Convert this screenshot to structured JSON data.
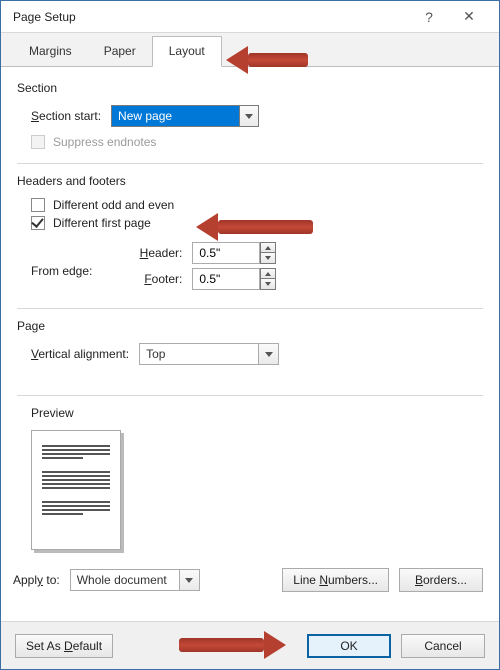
{
  "title": "Page Setup",
  "help": "?",
  "close": "✕",
  "tabs": {
    "margins": "Margins",
    "paper": "Paper",
    "layout": "Layout"
  },
  "section": {
    "header": "Section",
    "start_label": "Section start:",
    "start_value": "New page",
    "suppress_label": "Suppress endnotes"
  },
  "hf": {
    "header": "Headers and footers",
    "odd_even": "Different odd and even",
    "first_page": "Different first page",
    "from_edge": "From edge:",
    "header_label": "Header:",
    "header_value": "0.5\"",
    "footer_label": "Footer:",
    "footer_value": "0.5\""
  },
  "page": {
    "header": "Page",
    "valign_label": "Vertical alignment:",
    "valign_value": "Top"
  },
  "preview_label": "Preview",
  "apply_to_label": "Apply to:",
  "apply_to_value": "Whole document",
  "line_numbers_btn": "Line Numbers...",
  "borders_btn": "Borders...",
  "set_default_btn": "Set As Default",
  "ok_btn": "OK",
  "cancel_btn": "Cancel"
}
